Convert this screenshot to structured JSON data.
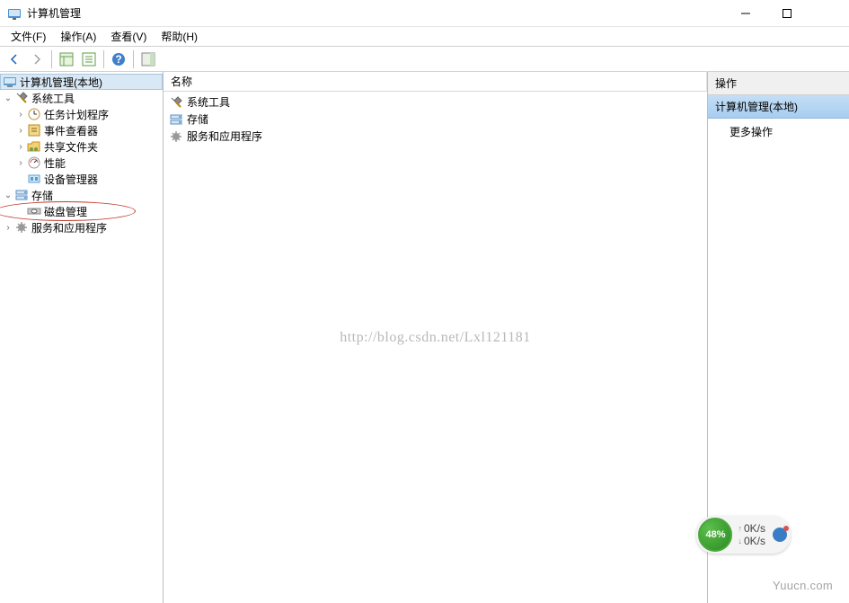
{
  "window": {
    "title": "计算机管理"
  },
  "menu": {
    "file": "文件(F)",
    "action": "操作(A)",
    "view": "查看(V)",
    "help": "帮助(H)"
  },
  "tree": {
    "root": "计算机管理(本地)",
    "systemTools": "系统工具",
    "taskScheduler": "任务计划程序",
    "eventViewer": "事件查看器",
    "sharedFolders": "共享文件夹",
    "performance": "性能",
    "deviceManager": "设备管理器",
    "storage": "存储",
    "diskManagement": "磁盘管理",
    "servicesApps": "服务和应用程序"
  },
  "list": {
    "headerName": "名称",
    "items": {
      "systemTools": "系统工具",
      "storage": "存储",
      "servicesApps": "服务和应用程序"
    }
  },
  "actions": {
    "header": "操作",
    "context": "计算机管理(本地)",
    "moreActions": "更多操作"
  },
  "watermark": "http://blog.csdn.net/Lxl121181",
  "widget": {
    "percent": "48%",
    "upSpeed": "0K/s",
    "downSpeed": "0K/s"
  },
  "footer": "Yuucn.com"
}
